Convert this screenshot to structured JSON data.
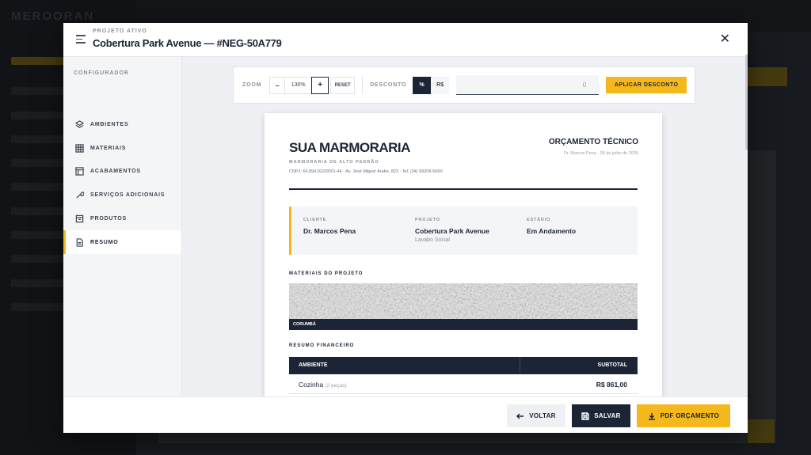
{
  "background": {
    "brand": "MEROORAN"
  },
  "header": {
    "project_label": "PROJETO ATIVO",
    "project_title": "Cobertura Park Avenue — #NEG-50A779",
    "close_glyph": "✕"
  },
  "sidebar": {
    "section_label": "CONFIGURADOR",
    "items": [
      {
        "label": "AMBIENTES",
        "icon": "layers-icon"
      },
      {
        "label": "MATERIAIS",
        "icon": "grid-icon"
      },
      {
        "label": "ACABAMENTOS",
        "icon": "panel-icon"
      },
      {
        "label": "SERVIÇOS ADICIONAIS",
        "icon": "wrench-icon"
      },
      {
        "label": "PRODUTOS",
        "icon": "box-icon"
      },
      {
        "label": "RESUMO",
        "icon": "document-icon",
        "active": true
      }
    ]
  },
  "toolbar": {
    "zoom_label": "ZOOM",
    "zoom_minus": "–",
    "zoom_value": "130%",
    "zoom_plus": "+",
    "reset_label": "RESET",
    "discount_label": "DESCONTO",
    "discount_percent": "%",
    "discount_currency": "R$",
    "discount_value": "0",
    "apply_label": "APLICAR DESCONTO"
  },
  "document": {
    "brand": "SUA MARMORARIA",
    "brand_subtitle": "MARMORARIA DE ALTO PADRÃO",
    "brand_address": "CNPJ: 64.894.922/0001-44 · Av. José Miguel Árabe, 823 · Tel: (34) 99209-5660",
    "doc_type": "ORÇAMENTO TÉCNICO",
    "doc_meta": "Dr. Marcos Pena · 30 de julho de 2026",
    "client": {
      "client_label": "CLIENTE",
      "client_name": "Dr. Marcos Pena",
      "project_label": "PROJETO",
      "project_name": "Cobertura Park Avenue",
      "project_sub": "Lavabo Social",
      "status_label": "ESTÁDIO",
      "status_value": "Em Andamento"
    },
    "materials_title": "MATERIAIS DO PROJETO",
    "material_name": "CORUMBÁ",
    "financial_title": "RESUMO FINANCEIRO",
    "table": {
      "col_environment": "AMBIENTE",
      "col_subtotal": "SUBTOTAL",
      "rows": [
        {
          "environment": "Cozinha",
          "pieces": "(2 peças)",
          "subtotal": "R$ 861,00"
        }
      ]
    }
  },
  "footer": {
    "back_label": "VOLTAR",
    "save_label": "SALVAR",
    "pdf_label": "PDF ORÇAMENTO"
  },
  "colors": {
    "accent": "#f5b81c",
    "navy": "#1b2535"
  }
}
